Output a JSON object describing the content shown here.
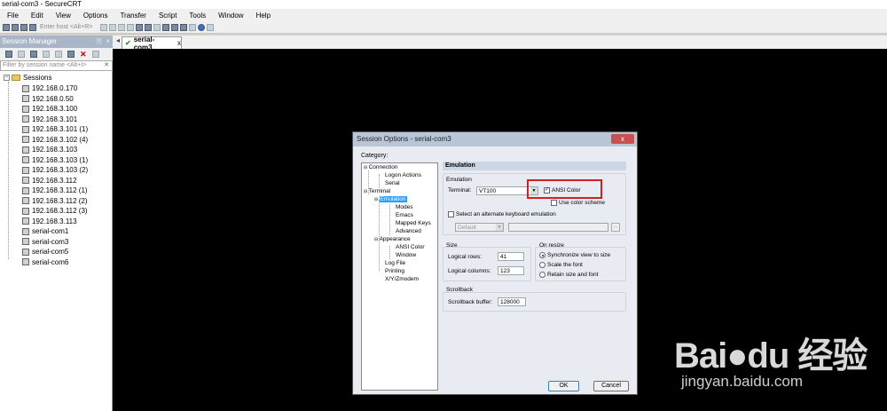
{
  "window": {
    "title": "serial-com3 - SecureCRT"
  },
  "menu": [
    "File",
    "Edit",
    "View",
    "Options",
    "Transfer",
    "Script",
    "Tools",
    "Window",
    "Help"
  ],
  "toolbar": {
    "host_placeholder": "Enter host <Alt+R>"
  },
  "session_manager": {
    "title": "Session Manager",
    "pin": "⎘",
    "filter_placeholder": "Filter by session name <Alt+I>",
    "root": "Sessions",
    "items": [
      "192.168.0.170",
      "192.168.0.50",
      "192.168.3.100",
      "192.168.3.101",
      "192.168.3.101 (1)",
      "192.168.3.102 (4)",
      "192.168.3.103",
      "192.168.3.103 (1)",
      "192.168.3.103 (2)",
      "192.168.3.112",
      "192.168.3.112 (1)",
      "192.168.3.112 (2)",
      "192.168.3.112 (3)",
      "192.168.3.113",
      "serial-com1",
      "serial-com3",
      "serial-com5",
      "serial-com6"
    ]
  },
  "tab": {
    "label": "serial-com3",
    "close": "x"
  },
  "dialog": {
    "title": "Session Options - serial-com3",
    "close": "x",
    "category_label": "Category:",
    "categories": {
      "connection": "Connection",
      "logon_actions": "Logon Actions",
      "serial": "Serial",
      "terminal": "Terminal",
      "emulation": "Emulation",
      "modes": "Modes",
      "emacs": "Emacs",
      "mapped_keys": "Mapped Keys",
      "advanced": "Advanced",
      "appearance": "Appearance",
      "ansi_color": "ANSI Color",
      "window": "Window",
      "log_file": "Log File",
      "printing": "Printing",
      "xyz_modem": "X/Y/Zmodem"
    },
    "pane_title": "Emulation",
    "emulation_group": "Emulation",
    "terminal_label": "Terminal:",
    "terminal_value": "VT100",
    "ansi_color": "ANSI Color",
    "ansi_color_checked": true,
    "use_color_scheme": "Use color scheme",
    "alt_keyboard": "Select an alternate keyboard emulation",
    "alt_keyboard_value": "Default",
    "size_group": "Size",
    "logical_rows_label": "Logical rows:",
    "logical_rows": "41",
    "logical_columns_label": "Logical columns:",
    "logical_columns": "123",
    "on_resize_group": "On resize",
    "resize_options": [
      "Synchronize view to size",
      "Scale the font",
      "Retain size and font"
    ],
    "resize_selected": "Synchronize view to size",
    "scrollback_group": "Scrollback",
    "scrollback_label": "Scrollback buffer:",
    "scrollback_value": "128000",
    "ok": "OK",
    "cancel": "Cancel",
    "ellipsis": "..."
  },
  "watermark": {
    "logo": "Bai●du 经验",
    "url": "jingyan.baidu.com"
  }
}
